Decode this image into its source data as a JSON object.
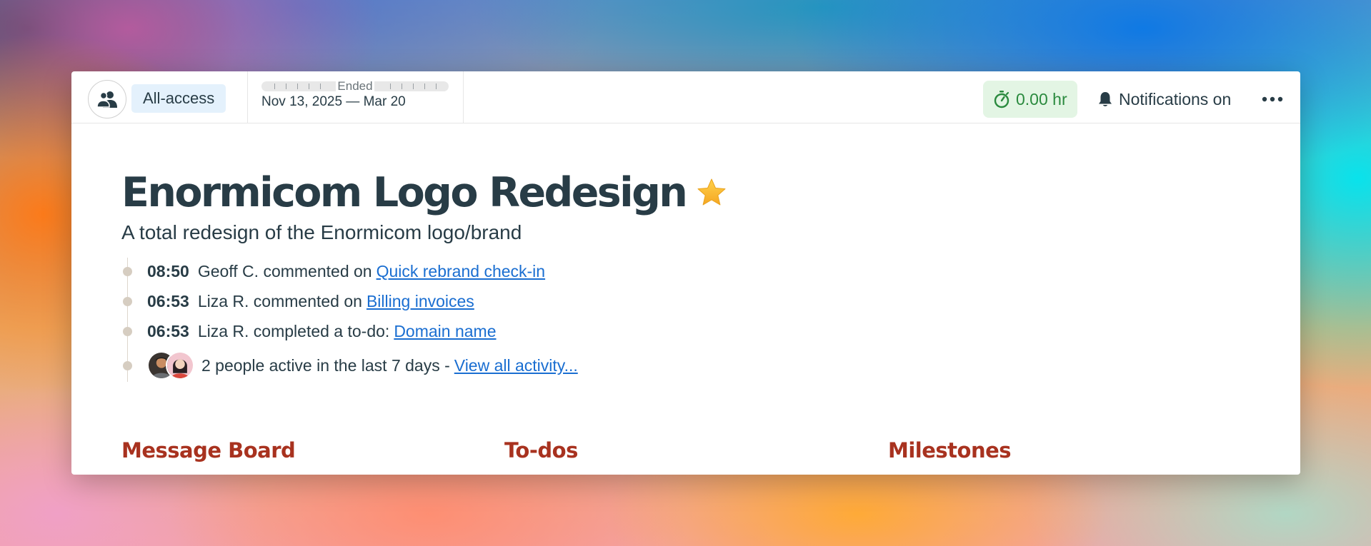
{
  "header": {
    "access_label": "All-access",
    "schedule_status": "Ended",
    "schedule_dates": "Nov 13, 2025 — Mar 20",
    "timer_value": "0.00 hr",
    "notifications_label": "Notifications on"
  },
  "project": {
    "title": "Enormicom Logo Redesign",
    "description": "A total redesign of the Enormicom logo/brand"
  },
  "activity": [
    {
      "time": "08:50",
      "text": "Geoff C. commented on",
      "link": "Quick rebrand check-in"
    },
    {
      "time": "06:53",
      "text": "Liza R. commented on",
      "link": "Billing invoices"
    },
    {
      "time": "06:53",
      "text": "Liza R. completed a to-do:",
      "link": "Domain name"
    }
  ],
  "activity_summary": {
    "text": "2 people active in the last 7 days -",
    "link": "View all activity..."
  },
  "tools": [
    "Message Board",
    "To-dos",
    "Milestones"
  ],
  "colors": {
    "title": "#283c46",
    "link": "#1a6ed1",
    "tool_heading": "#a8321f",
    "timer_bg": "#e3f5e4",
    "timer_text": "#2a8a3e",
    "access_bg": "#e4f1fc"
  },
  "icons": {
    "people": "people-icon",
    "timer": "stopwatch-icon",
    "bell": "bell-icon",
    "more": "ellipsis-icon",
    "star": "star-icon"
  }
}
